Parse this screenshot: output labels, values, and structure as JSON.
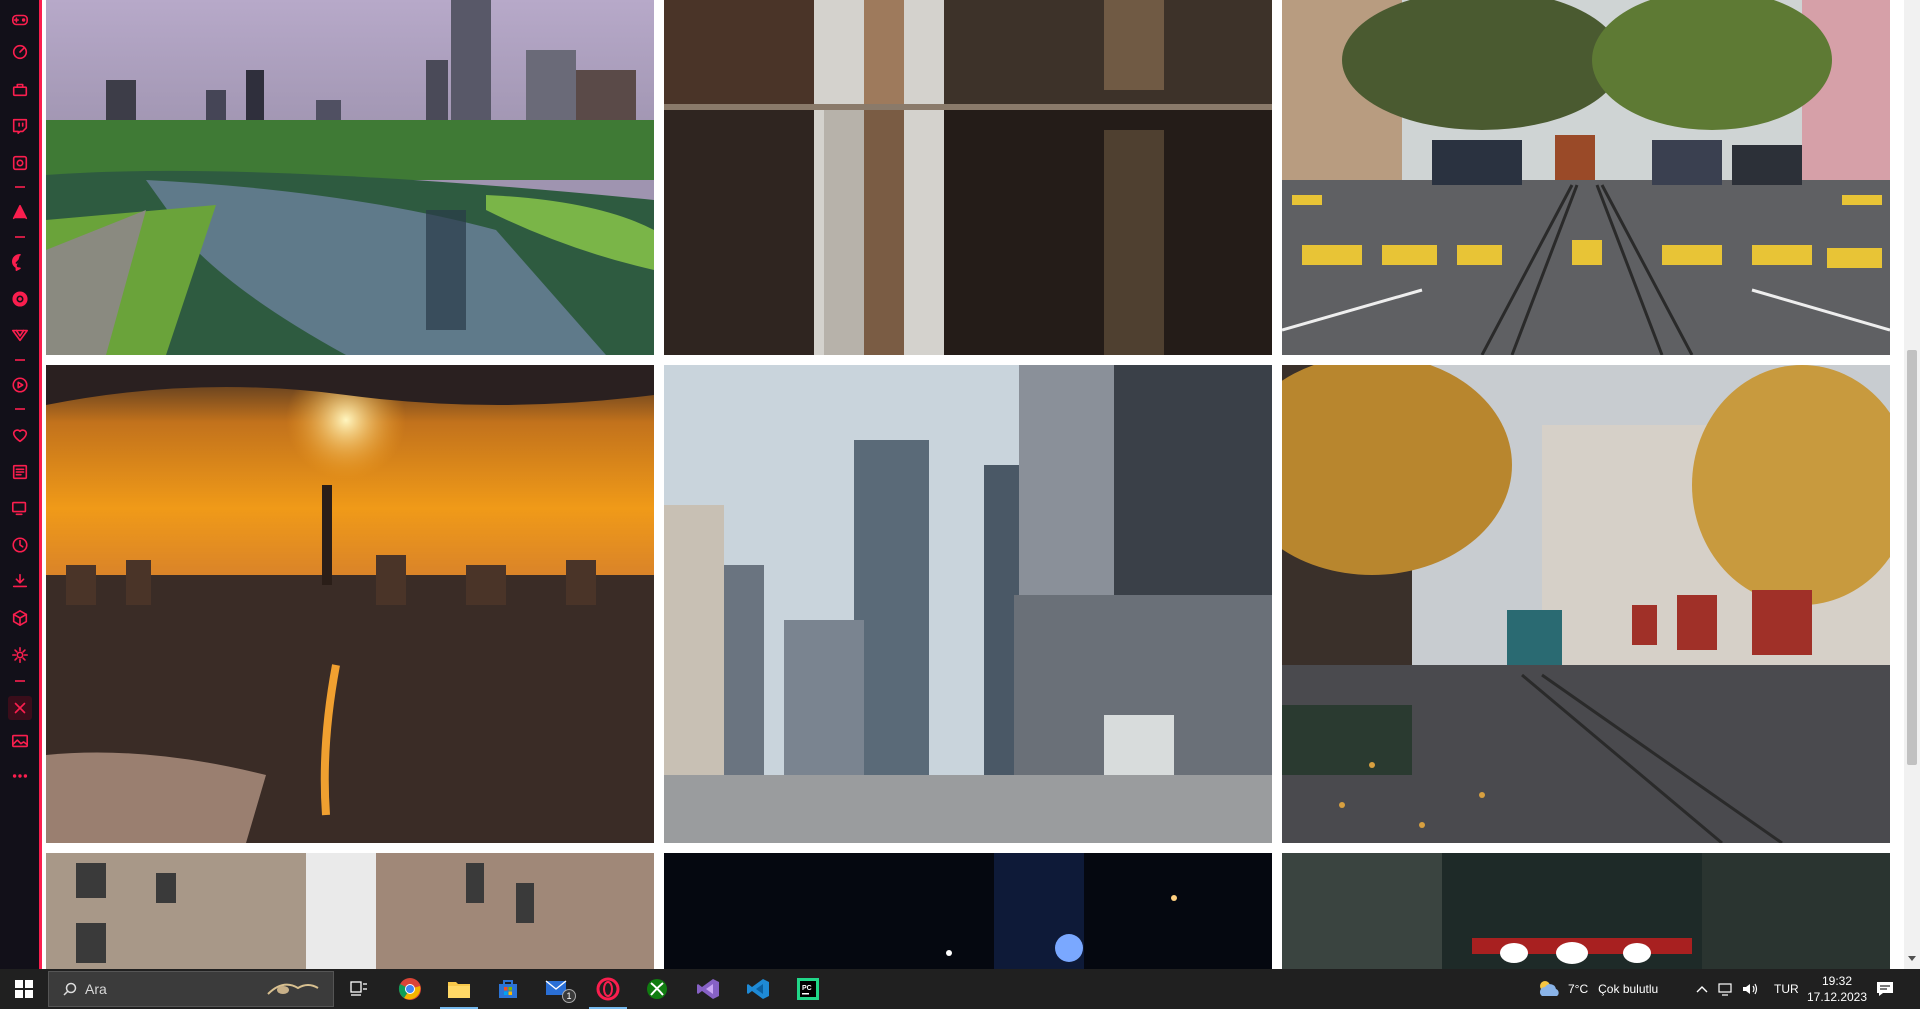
{
  "sidebar": {
    "accent_color": "#fa1e4e",
    "items": [
      {
        "name": "gx-corner-icon"
      },
      {
        "name": "speed-dial-icon"
      },
      {
        "name": "gx-store-icon"
      },
      {
        "name": "twitch-icon"
      },
      {
        "name": "gx-control-icon"
      },
      {
        "name": "aria-icon"
      },
      {
        "name": "messenger-icon"
      },
      {
        "name": "whatsapp-icon"
      },
      {
        "name": "vk-icon"
      },
      {
        "name": "player-icon"
      },
      {
        "name": "bookmarks-icon"
      },
      {
        "name": "news-icon"
      },
      {
        "name": "snapshots-icon"
      },
      {
        "name": "history-icon"
      },
      {
        "name": "downloads-icon"
      },
      {
        "name": "extensions-icon"
      },
      {
        "name": "settings-icon"
      },
      {
        "name": "active-extension-icon"
      },
      {
        "name": "wallpaper-icon"
      },
      {
        "name": "more-icon"
      }
    ]
  },
  "gallery": {
    "tiles": [
      {
        "name": "photo-city-park-lake"
      },
      {
        "name": "photo-street-reflection"
      },
      {
        "name": "photo-san-francisco-cable-car"
      },
      {
        "name": "photo-sunset-skyline"
      },
      {
        "name": "photo-downtown-skyscrapers"
      },
      {
        "name": "photo-autumn-tram-street"
      },
      {
        "name": "photo-building-alley"
      },
      {
        "name": "photo-night-street"
      },
      {
        "name": "photo-night-lanterns"
      }
    ]
  },
  "taskbar": {
    "search_placeholder": "Ara",
    "apps": [
      {
        "name": "task-view-icon"
      },
      {
        "name": "chrome-icon"
      },
      {
        "name": "file-explorer-icon"
      },
      {
        "name": "microsoft-store-icon"
      },
      {
        "name": "mail-icon",
        "badge": "1"
      },
      {
        "name": "opera-gx-icon"
      },
      {
        "name": "xbox-icon"
      },
      {
        "name": "visual-studio-icon"
      },
      {
        "name": "vscode-icon"
      },
      {
        "name": "pycharm-icon"
      }
    ],
    "weather": {
      "temp": "7°C",
      "condition": "Çok bulutlu"
    },
    "language": "TUR",
    "time": "19:32",
    "date": "17.12.2023"
  }
}
